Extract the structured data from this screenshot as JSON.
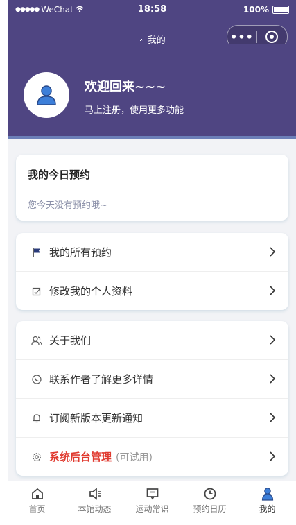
{
  "status_bar": {
    "carrier": "WeChat",
    "time": "18:58",
    "battery": "100%"
  },
  "navbar": {
    "title": "我的",
    "more_label": "•••"
  },
  "profile": {
    "welcome": "欢迎回来~~~",
    "subtitle": "马上注册，使用更多功能"
  },
  "today": {
    "title": "我的今日预约",
    "empty_text": "您今天没有预约哦~"
  },
  "group1": [
    {
      "label": "我的所有预约",
      "icon": "flag-icon"
    },
    {
      "label": "修改我的个人资料",
      "icon": "edit-icon"
    }
  ],
  "group2": [
    {
      "label": "关于我们",
      "icon": "users-icon"
    },
    {
      "label": "联系作者了解更多详情",
      "icon": "phone-icon"
    },
    {
      "label": "订阅新版本更新通知",
      "icon": "bell-icon"
    },
    {
      "label": "系统后台管理",
      "extra": "(可试用)",
      "icon": "gear-icon"
    }
  ],
  "tabs": [
    {
      "label": "首页",
      "icon": "home-icon"
    },
    {
      "label": "本馆动态",
      "icon": "news-icon"
    },
    {
      "label": "运动常识",
      "icon": "message-icon"
    },
    {
      "label": "预约日历",
      "icon": "clock-icon"
    },
    {
      "label": "我的",
      "icon": "user-icon",
      "active": true
    }
  ],
  "colors": {
    "header": "#4f4582",
    "accent": "#3d7fd9",
    "admin_red": "#e03a2f"
  }
}
